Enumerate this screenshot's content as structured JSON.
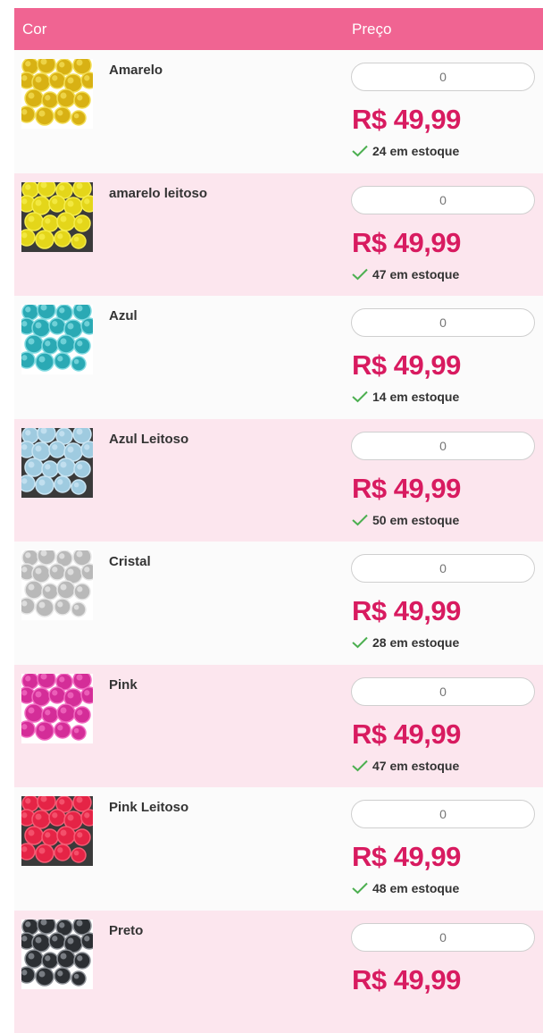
{
  "header": {
    "col_color": "Cor",
    "col_price": "Preço"
  },
  "qty_placeholder": "0",
  "rows": [
    {
      "name": "Amarelo",
      "price": "R$ 49,99",
      "stock": "24 em estoque",
      "thumb_color": "#d8b114",
      "thumb_light": "#f2dc52",
      "thumb_bg": "#ffffff",
      "thumb_image": "amarelo-gems"
    },
    {
      "name": "amarelo leitoso",
      "price": "R$ 49,99",
      "stock": "47 em estoque",
      "thumb_color": "#e4d61a",
      "thumb_light": "#f5ec4a",
      "thumb_bg": "#3a3a3a",
      "thumb_image": "amarelo-leitoso-gems"
    },
    {
      "name": "Azul",
      "price": "R$ 49,99",
      "stock": "14 em estoque",
      "thumb_color": "#2aa9b4",
      "thumb_light": "#7fd9e0",
      "thumb_bg": "#ffffff",
      "thumb_image": "azul-gems"
    },
    {
      "name": "Azul Leitoso",
      "price": "R$ 49,99",
      "stock": "50 em estoque",
      "thumb_color": "#9fcbe0",
      "thumb_light": "#c9e4f2",
      "thumb_bg": "#3a3a3a",
      "thumb_image": "azul-leitoso-gems"
    },
    {
      "name": "Cristal",
      "price": "R$ 49,99",
      "stock": "28 em estoque",
      "thumb_color": "#b9b9b9",
      "thumb_light": "#e6e6e6",
      "thumb_bg": "#ffffff",
      "thumb_image": "cristal-gems"
    },
    {
      "name": "Pink",
      "price": "R$ 49,99",
      "stock": "47 em estoque",
      "thumb_color": "#d42d98",
      "thumb_light": "#f06ac0",
      "thumb_bg": "#ffffff",
      "thumb_image": "pink-gems"
    },
    {
      "name": "Pink Leitoso",
      "price": "R$ 49,99",
      "stock": "48 em estoque",
      "thumb_color": "#e52446",
      "thumb_light": "#f65b74",
      "thumb_bg": "#3a3a3a",
      "thumb_image": "pink-leitoso-gems"
    },
    {
      "name": "Preto",
      "price": "R$ 49,99",
      "stock": "",
      "thumb_color": "#2c2f33",
      "thumb_light": "#8c9096",
      "thumb_bg": "#ffffff",
      "thumb_image": "preto-gems"
    }
  ],
  "colors": {
    "header_bg": "#f06492",
    "price": "#d81b60",
    "check": "#4caf50",
    "row_alt": "#fce6ee"
  }
}
